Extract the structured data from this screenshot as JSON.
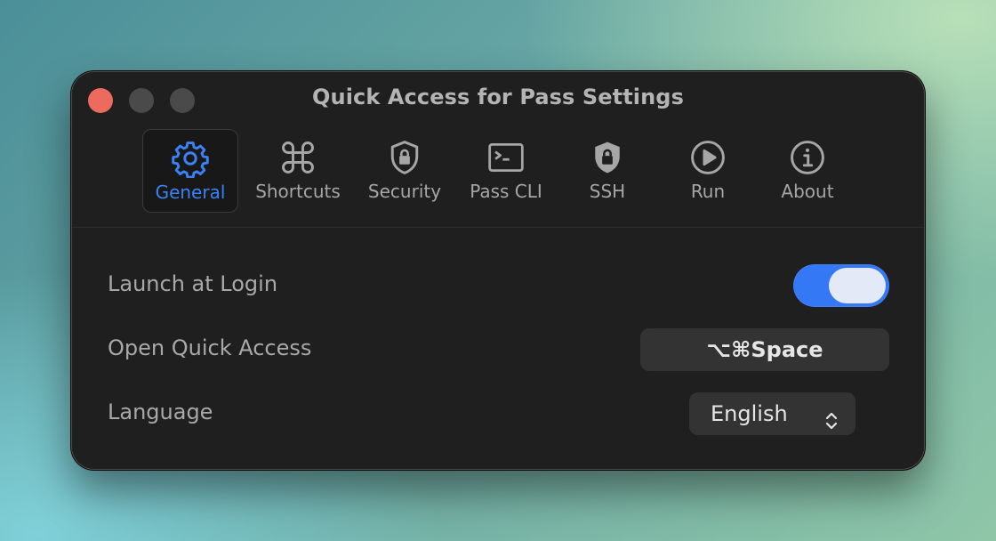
{
  "window": {
    "title": "Quick Access for Pass Settings"
  },
  "toolbar": {
    "tabs": [
      {
        "label": "General",
        "icon": "gear-icon",
        "active": true
      },
      {
        "label": "Shortcuts",
        "icon": "command-icon",
        "active": false
      },
      {
        "label": "Security",
        "icon": "shield-lock-icon",
        "active": false
      },
      {
        "label": "Pass CLI",
        "icon": "terminal-icon",
        "active": false
      },
      {
        "label": "SSH",
        "icon": "shield-lock-filled-icon",
        "active": false
      },
      {
        "label": "Run",
        "icon": "play-circle-icon",
        "active": false
      },
      {
        "label": "About",
        "icon": "info-circle-icon",
        "active": false
      }
    ]
  },
  "settings": {
    "launch_at_login": {
      "label": "Launch at Login",
      "enabled": true
    },
    "open_quick_access": {
      "label": "Open Quick Access",
      "shortcut": "⌥⌘Space"
    },
    "language": {
      "label": "Language",
      "value": "English"
    }
  },
  "colors": {
    "accent": "#3b82f6",
    "window_bg": "#1f1f1f",
    "close_button": "#ec6a5e"
  }
}
